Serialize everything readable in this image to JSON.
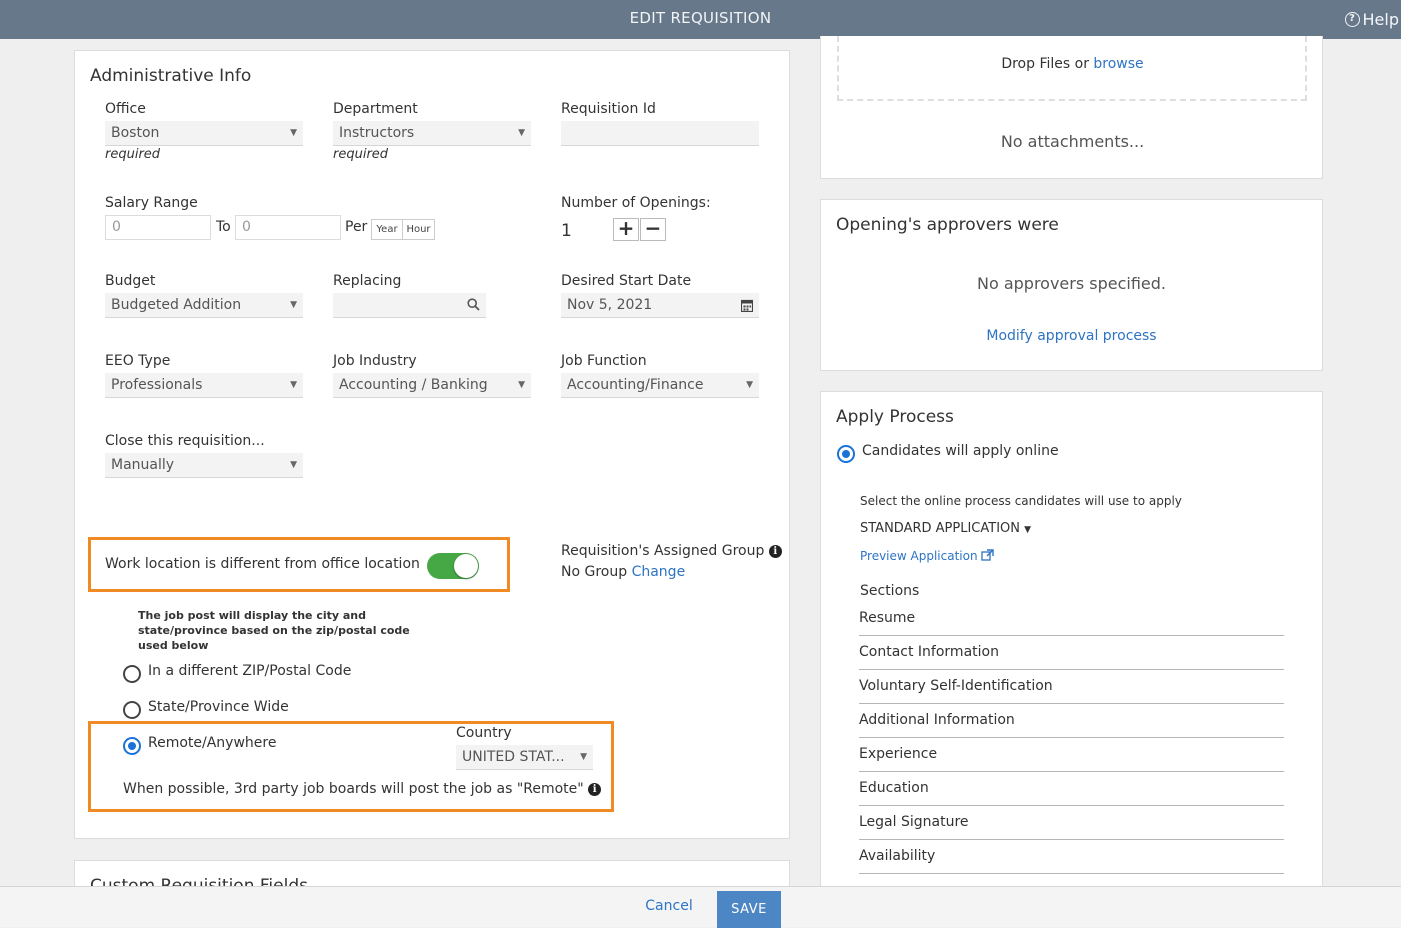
{
  "header": {
    "title": "EDIT REQUISITION",
    "help_label": "Help"
  },
  "admin": {
    "title": "Administrative Info",
    "office": {
      "label": "Office",
      "value": "Boston",
      "note": "required"
    },
    "department": {
      "label": "Department",
      "value": "Instructors",
      "note": "required"
    },
    "requisition_id": {
      "label": "Requisition Id",
      "value": ""
    },
    "salary": {
      "label": "Salary Range",
      "from": "0",
      "to_label": "To",
      "to": "0",
      "per_label": "Per",
      "year": "Year",
      "hour": "Hour"
    },
    "openings": {
      "label": "Number of Openings:",
      "value": "1",
      "plus": "+",
      "minus": "−"
    },
    "budget": {
      "label": "Budget",
      "value": "Budgeted Addition"
    },
    "replacing": {
      "label": "Replacing",
      "value": ""
    },
    "start_date": {
      "label": "Desired Start Date",
      "value": "Nov 5, 2021"
    },
    "eeo": {
      "label": "EEO Type",
      "value": "Professionals"
    },
    "industry": {
      "label": "Job Industry",
      "value": "Accounting / Banking"
    },
    "function": {
      "label": "Job Function",
      "value": "Accounting/Finance"
    },
    "close": {
      "label": "Close this requisition...",
      "value": "Manually"
    },
    "work_location": {
      "label": "Work location is different from office location",
      "enabled": true
    },
    "assigned_group": {
      "label": "Requisition's Assigned Group",
      "value": "No Group",
      "change": "Change"
    },
    "location_note": [
      "The job post will display the city and",
      "state/province based on the zip/postal code",
      "used below"
    ],
    "options": [
      {
        "label": "In a different ZIP/Postal Code",
        "selected": false
      },
      {
        "label": "State/Province Wide",
        "selected": false
      },
      {
        "label": "Remote/Anywhere",
        "selected": true
      }
    ],
    "country": {
      "label": "Country",
      "value": "UNITED STAT..."
    },
    "remote_note": "When possible, 3rd party job boards will post the job as \"Remote\""
  },
  "custom_fields": {
    "title": "Custom Requisition Fields"
  },
  "attachments": {
    "drop_text": "Drop Files or ",
    "browse": "browse",
    "empty": "No attachments..."
  },
  "approvers": {
    "title": "Opening's approvers were",
    "empty": "No approvers specified.",
    "modify": "Modify approval process"
  },
  "apply": {
    "title": "Apply Process",
    "online_label": "Candidates will apply online",
    "select_text": "Select the online process candidates will use to apply",
    "application": "STANDARD APPLICATION",
    "preview": "Preview Application",
    "sections_label": "Sections",
    "sections": [
      "Resume",
      "Contact Information",
      "Voluntary Self-Identification",
      "Additional Information",
      "Experience",
      "Education",
      "Legal Signature",
      "Availability"
    ]
  },
  "footer": {
    "cancel": "Cancel",
    "save": "SAVE"
  },
  "colors": {
    "header": "#66788a",
    "accent": "#2d74c4",
    "highlight": "#f08a24",
    "toggle": "#45a845",
    "save": "#4d86c4"
  },
  "icons": [
    "help-icon",
    "caret-down-icon",
    "search-icon",
    "calendar-icon",
    "info-icon",
    "external-link-icon"
  ]
}
